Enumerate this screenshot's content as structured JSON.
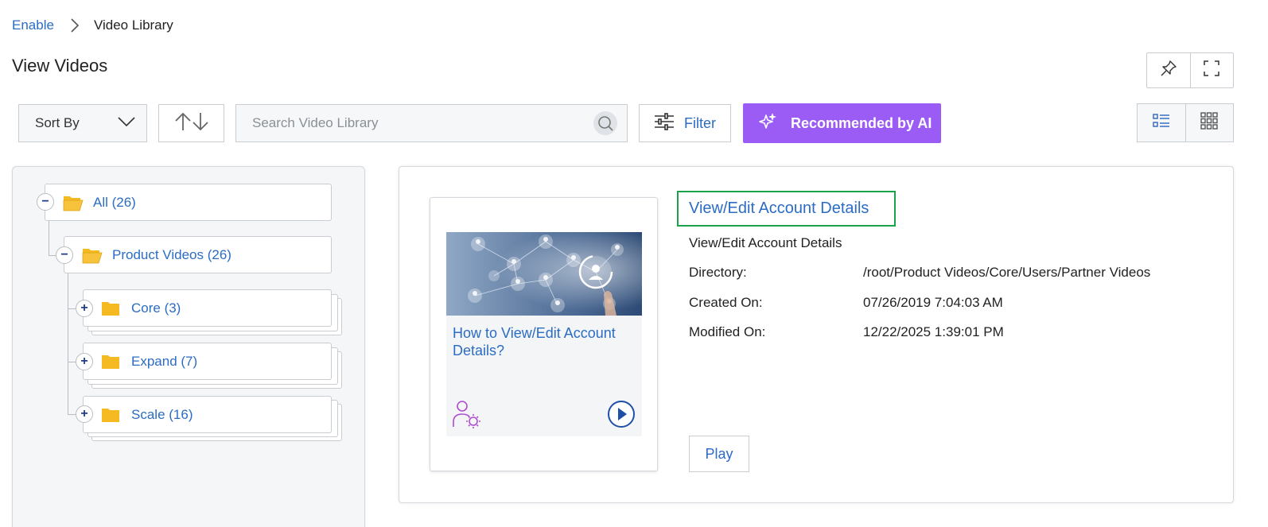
{
  "breadcrumb": {
    "root": "Enable",
    "current": "Video Library"
  },
  "page": {
    "title": "View Videos"
  },
  "top_actions": {
    "pin_icon": "pin-icon",
    "fullscreen_icon": "fullscreen-icon"
  },
  "toolbar": {
    "sort_label": "Sort By",
    "search_placeholder": "Search Video Library",
    "filter_label": "Filter",
    "ai_label": "Recommended by AI",
    "ai_color": "#9b5cf6",
    "view_modes": [
      "list-view-icon",
      "grid-view-icon"
    ]
  },
  "tree": {
    "root": {
      "label": "All (26)",
      "state": "expanded"
    },
    "child": {
      "label": "Product Videos (26)",
      "state": "expanded"
    },
    "folders": [
      {
        "label": "Core (3)",
        "state": "collapsed"
      },
      {
        "label": "Expand (7)",
        "state": "collapsed"
      },
      {
        "label": "Scale (16)",
        "state": "collapsed"
      }
    ]
  },
  "video": {
    "card_title": "How to View/Edit Account Details?",
    "title": "View/Edit Account Details",
    "subtitle": "View/Edit Account Details",
    "meta": [
      {
        "label": "Directory:",
        "value": "/root/Product Videos/Core/Users/Partner Videos"
      },
      {
        "label": "Created On:",
        "value": "07/26/2019 7:04:03 AM"
      },
      {
        "label": "Modified On:",
        "value": "12/22/2025 1:39:01 PM"
      }
    ],
    "play_label": "Play"
  },
  "colors": {
    "link": "#2b6cc4",
    "selection_border": "#1aa34a",
    "folder": "#f5b921"
  }
}
